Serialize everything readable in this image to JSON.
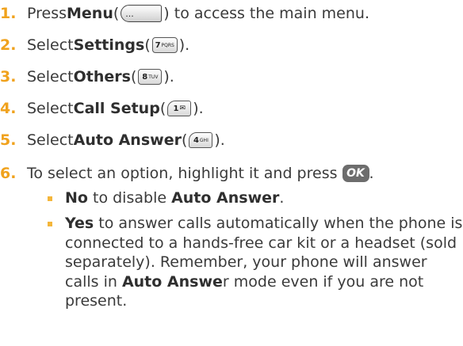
{
  "steps": [
    {
      "num": "1.",
      "pre": "Press ",
      "bold": "Menu",
      "open": " (",
      "key": "menu-key",
      "key_label": "...",
      "post": ") to access the main menu."
    },
    {
      "num": "2.",
      "pre": "Select ",
      "bold": "Settings",
      "open": " (",
      "key": "7",
      "key_sub": "PQRS",
      "post": ")."
    },
    {
      "num": "3.",
      "pre": "Select ",
      "bold": "Others",
      "open": " (",
      "key": "8",
      "key_sub": "TUV",
      "post": ")."
    },
    {
      "num": "4.",
      "pre": "Select ",
      "bold": "Call Setup",
      "open": " (",
      "key": "1",
      "key_sub": "✉",
      "post": ")."
    },
    {
      "num": "5.",
      "pre": "Select ",
      "bold": "Auto Answer",
      "open": " (",
      "key": "4",
      "key_sub": "GHI",
      "post": ")."
    },
    {
      "num": "6.",
      "pre": "To select an option, highlight it and press ",
      "key": "OK",
      "post": "."
    }
  ],
  "bullets": [
    {
      "bold": "No",
      "text": " to disable ",
      "bold2": "Auto Answer",
      "tail": "."
    },
    {
      "bold": "Yes",
      "lines": [
        " to answer calls automatically when the phone is",
        "connected to a hands-free car kit or a headset (sold",
        "separately). Remember, your phone will answer",
        "calls in ",
        "present."
      ],
      "bold2": "Auto Answe",
      "line4_tail": "r mode even if you are not"
    }
  ],
  "colors": {
    "number": "#f0a21d",
    "bullet": "#f4b63b",
    "text": "#3a3a3a"
  }
}
